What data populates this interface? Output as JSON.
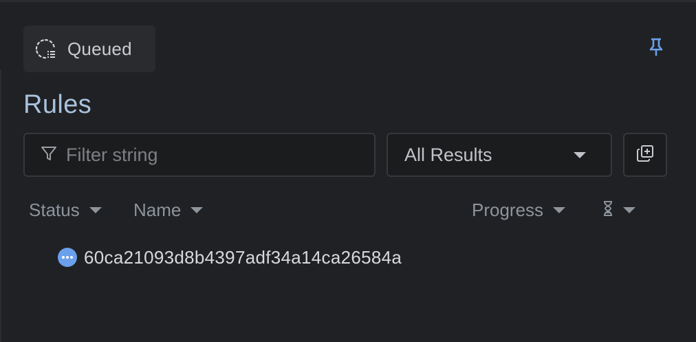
{
  "status_chip": {
    "label": "Queued",
    "icon": "queue-spinner-icon"
  },
  "pin": {
    "icon": "pin-icon",
    "color": "#6aa0ec"
  },
  "title": "Rules",
  "filter": {
    "placeholder": "Filter string",
    "value": "",
    "icon": "filter-icon"
  },
  "results_select": {
    "selected": "All Results"
  },
  "action_button": {
    "icon": "copy-add-icon"
  },
  "columns": [
    {
      "label": "Status"
    },
    {
      "label": "Name"
    },
    {
      "label": "Progress"
    },
    {
      "label": "",
      "icon": "hourglass-icon"
    }
  ],
  "rows": [
    {
      "status": "queued",
      "status_color": "#6aa0ec",
      "name": "60ca21093d8b4397adf34a14ca26584a"
    }
  ]
}
